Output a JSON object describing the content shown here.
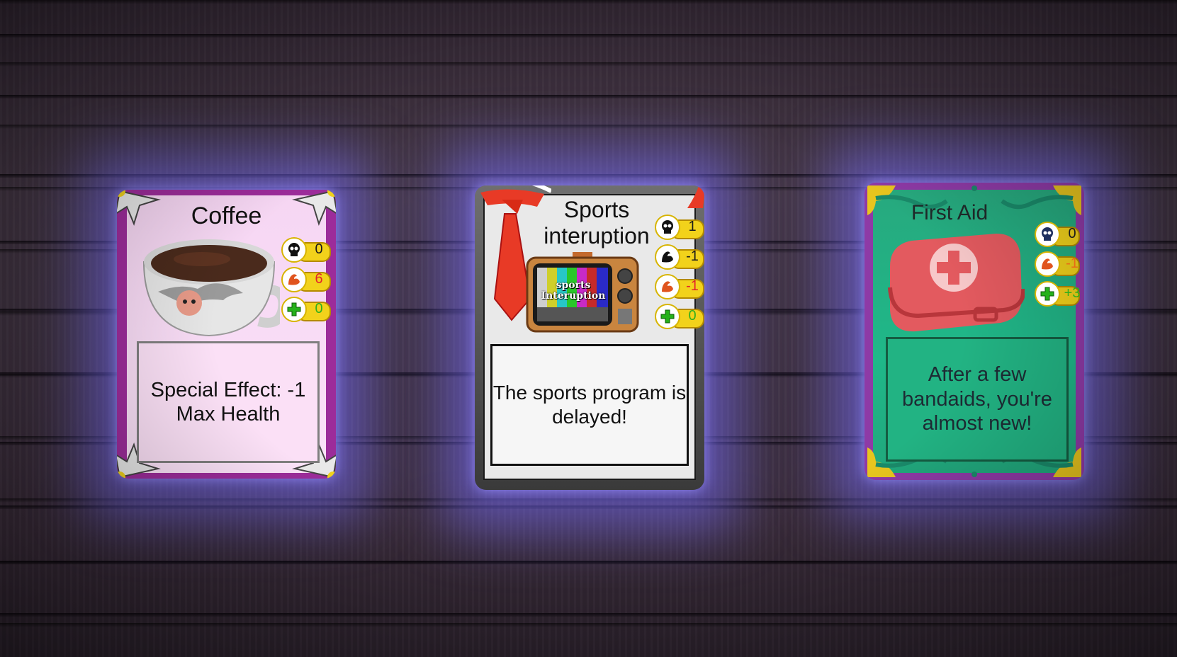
{
  "cards": [
    {
      "title": "Coffee",
      "description": "Special Effect: -1 Max Health",
      "stats": [
        {
          "icon": "skull-icon",
          "value": "0"
        },
        {
          "icon": "orange-muscle-icon",
          "value": "6"
        },
        {
          "icon": "green-plus-icon",
          "value": "0"
        }
      ],
      "art": "coffee-cup-image"
    },
    {
      "title": "Sports interuption",
      "description": "The sports program is delayed!",
      "tv_text": "sports Interuption",
      "stats": [
        {
          "icon": "skull-icon",
          "value": "1"
        },
        {
          "icon": "black-muscle-icon",
          "value": "-1"
        },
        {
          "icon": "orange-muscle-icon",
          "value": "-1"
        },
        {
          "icon": "green-plus-icon",
          "value": "0"
        }
      ],
      "art": "retro-tv-image"
    },
    {
      "title": "First Aid",
      "description": "After a few bandaids, you're almost new!",
      "stats": [
        {
          "icon": "skull-icon",
          "value": "0"
        },
        {
          "icon": "orange-muscle-icon",
          "value": "-1"
        },
        {
          "icon": "green-plus-icon",
          "value": "+3"
        }
      ],
      "art": "first-aid-kit-image"
    }
  ],
  "colors": {
    "glow": "#7a6eff",
    "coffee_frame": "#9c2c9a",
    "aid_frame": "#8e3aa6",
    "aid_fill": "#22b383",
    "stat_pill": "#f2d21b"
  }
}
